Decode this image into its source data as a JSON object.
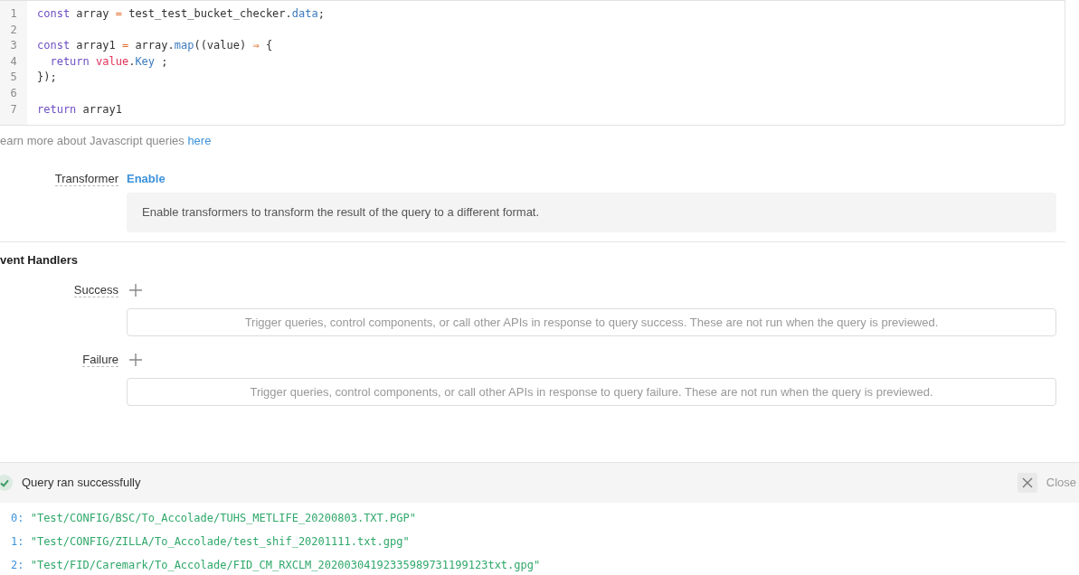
{
  "editor": {
    "lines": [
      {
        "number": "1",
        "tokens": [
          {
            "kind": "keyword",
            "text": "const"
          },
          {
            "kind": "plain",
            "text": " array "
          },
          {
            "kind": "operator",
            "text": "="
          },
          {
            "kind": "plain",
            "text": " test_test_bucket_checker."
          },
          {
            "kind": "property",
            "text": "data"
          },
          {
            "kind": "plain",
            "text": ";"
          }
        ]
      },
      {
        "number": "2"
      },
      {
        "number": "3",
        "tokens": [
          {
            "kind": "keyword",
            "text": "const"
          },
          {
            "kind": "plain",
            "text": " array1 "
          },
          {
            "kind": "operator",
            "text": "="
          },
          {
            "kind": "plain",
            "text": " array."
          },
          {
            "kind": "property",
            "text": "map"
          },
          {
            "kind": "plain",
            "text": "((value) "
          },
          {
            "kind": "operator",
            "text": "⇒"
          },
          {
            "kind": "plain",
            "text": " {"
          }
        ]
      },
      {
        "number": "4",
        "tokens": [
          {
            "kind": "keyword",
            "text": "  return "
          },
          {
            "kind": "variable",
            "text": "value"
          },
          {
            "kind": "plain",
            "text": "."
          },
          {
            "kind": "property",
            "text": "Key"
          },
          {
            "kind": "plain",
            "text": " ;"
          }
        ]
      },
      {
        "number": "5",
        "tokens": [
          {
            "kind": "plain",
            "text": "});"
          }
        ]
      },
      {
        "number": "6"
      },
      {
        "number": "7",
        "tokens": [
          {
            "kind": "keyword",
            "text": "return"
          },
          {
            "kind": "plain",
            "text": " array1"
          }
        ]
      }
    ]
  },
  "learn_more": {
    "text": "earn more about Javascript queries",
    "link": "here"
  },
  "transformer": {
    "label": "Transformer",
    "action": "Enable",
    "description": "Enable transformers to transform the result of the query to a different format."
  },
  "event_handlers": {
    "title": "vent Handlers",
    "handlers": [
      {
        "label": "Success",
        "hint": "Trigger queries, control components, or call other APIs in response to query success. These are not run when the query is previewed."
      },
      {
        "label": "Failure",
        "hint": "Trigger queries, control components, or call other APIs in response to query failure. These are not run when the query is previewed."
      }
    ]
  },
  "result": {
    "status": "Query ran successfully",
    "close": "Close",
    "rows": [
      {
        "index": "0:",
        "value": "\"Test/CONFIG/BSC/To_Accolade/TUHS_METLIFE_20200803.TXT.PGP\""
      },
      {
        "index": "1:",
        "value": "\"Test/CONFIG/ZILLA/To_Accolade/test_shif_20201111.txt.gpg\""
      },
      {
        "index": "2:",
        "value": "\"Test/FID/Caremark/To_Accolade/FID_CM_RXCLM_20200304192335989731199123txt.gpg\""
      }
    ]
  }
}
